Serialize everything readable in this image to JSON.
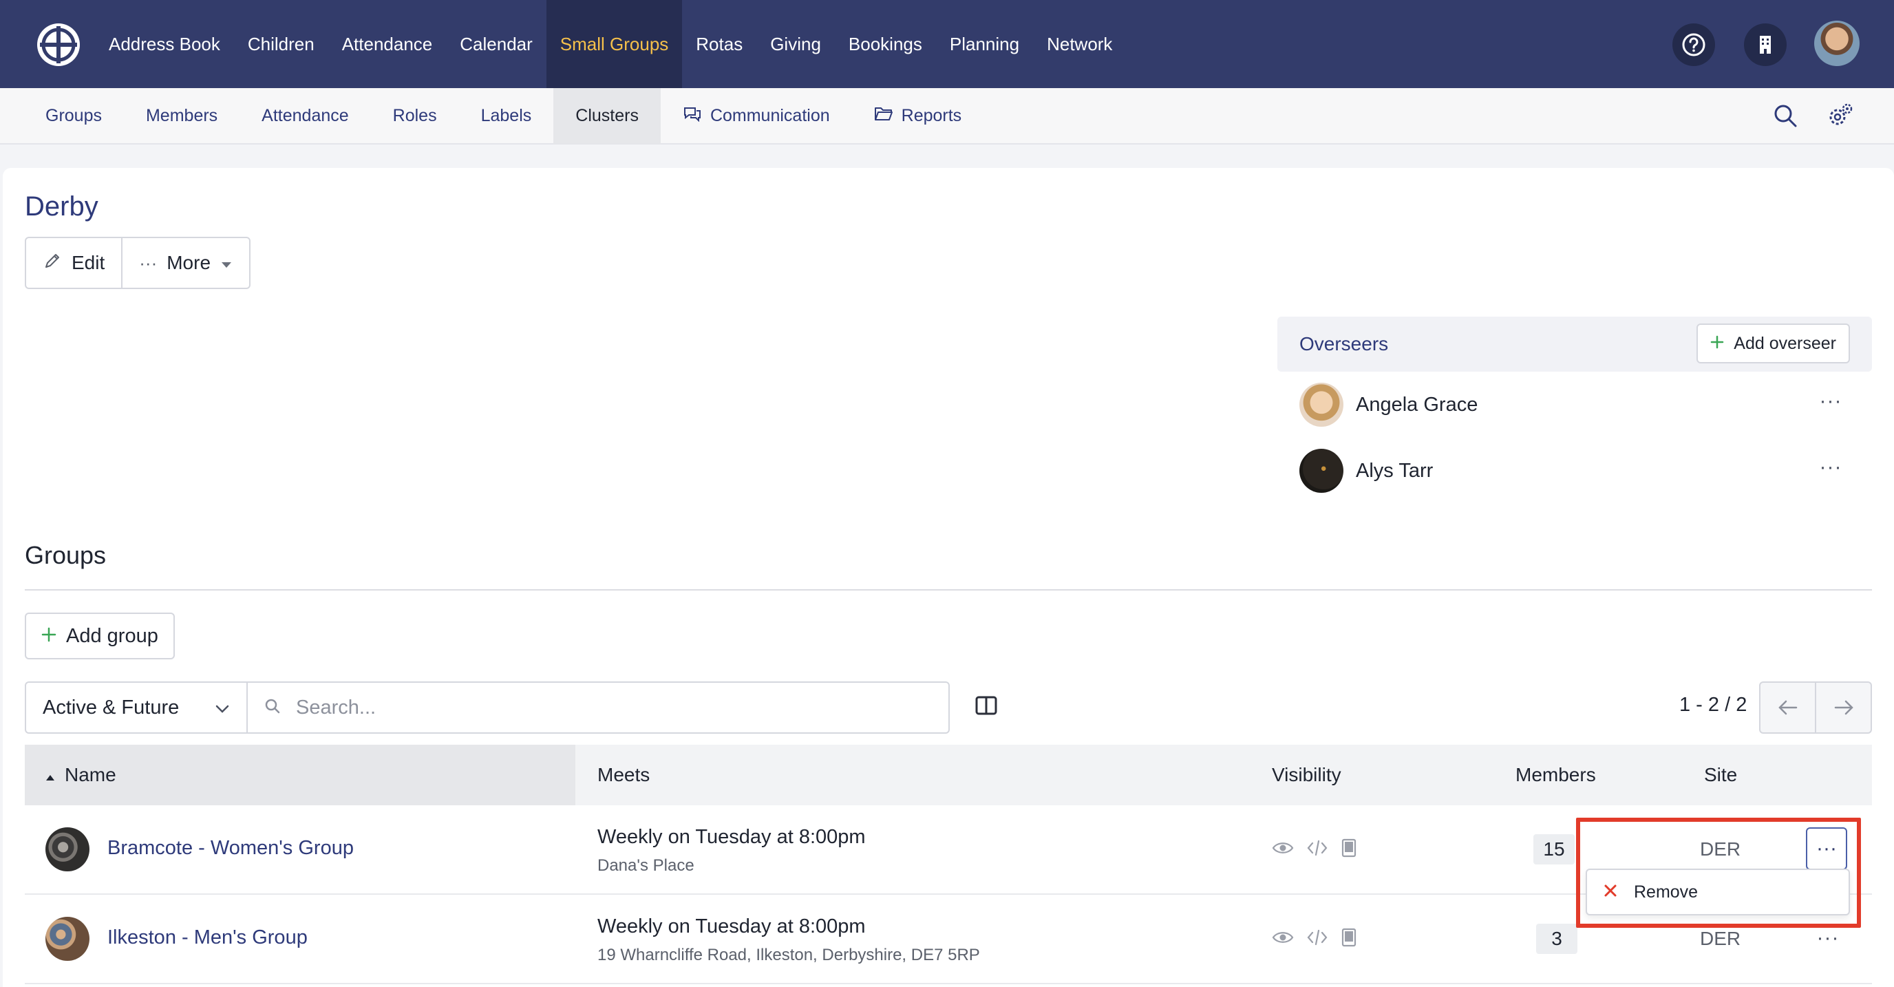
{
  "topnav": {
    "items": [
      "Address Book",
      "Children",
      "Attendance",
      "Calendar",
      "Small Groups",
      "Rotas",
      "Giving",
      "Bookings",
      "Planning",
      "Network"
    ],
    "active_index": 4,
    "active_color": "#f5c04a",
    "bg_color": "#333c6b",
    "icons": [
      "help-icon",
      "building-icon",
      "user-avatar"
    ]
  },
  "subnav": {
    "items": [
      {
        "label": "Groups",
        "icon": ""
      },
      {
        "label": "Members",
        "icon": ""
      },
      {
        "label": "Attendance",
        "icon": ""
      },
      {
        "label": "Roles",
        "icon": ""
      },
      {
        "label": "Labels",
        "icon": ""
      },
      {
        "label": "Clusters",
        "icon": ""
      },
      {
        "label": "Communication",
        "icon": "chat-icon"
      },
      {
        "label": "Reports",
        "icon": "folder-icon"
      }
    ],
    "active_index": 5,
    "right_icons": [
      "search-icon",
      "settings-icon"
    ]
  },
  "page": {
    "title": "Derby",
    "edit_label": "Edit",
    "more_label": "More"
  },
  "overseers": {
    "title": "Overseers",
    "add_label": "Add overseer",
    "people": [
      {
        "name": "Angela Grace"
      },
      {
        "name": "Alys Tarr"
      }
    ]
  },
  "groups": {
    "title": "Groups",
    "add_label": "Add group",
    "filter_value": "Active & Future",
    "search_placeholder": "Search...",
    "pager_text": "1 - 2 / 2",
    "columns": {
      "name": "Name",
      "meets": "Meets",
      "visibility": "Visibility",
      "members": "Members",
      "site": "Site"
    },
    "rows": [
      {
        "name": "Bramcote - Women's Group",
        "meets": "Weekly on Tuesday at 8:00pm",
        "place": "Dana's Place",
        "members": "15",
        "site": "DER"
      },
      {
        "name": "Ilkeston - Men's Group",
        "meets": "Weekly on Tuesday at 8:00pm",
        "place": "19 Wharncliffe Road, Ilkeston, Derbyshire, DE7 5RP",
        "members": "3",
        "site": "DER"
      }
    ],
    "row_menu": {
      "remove_label": "Remove",
      "highlight_color": "#e23b2a"
    }
  }
}
